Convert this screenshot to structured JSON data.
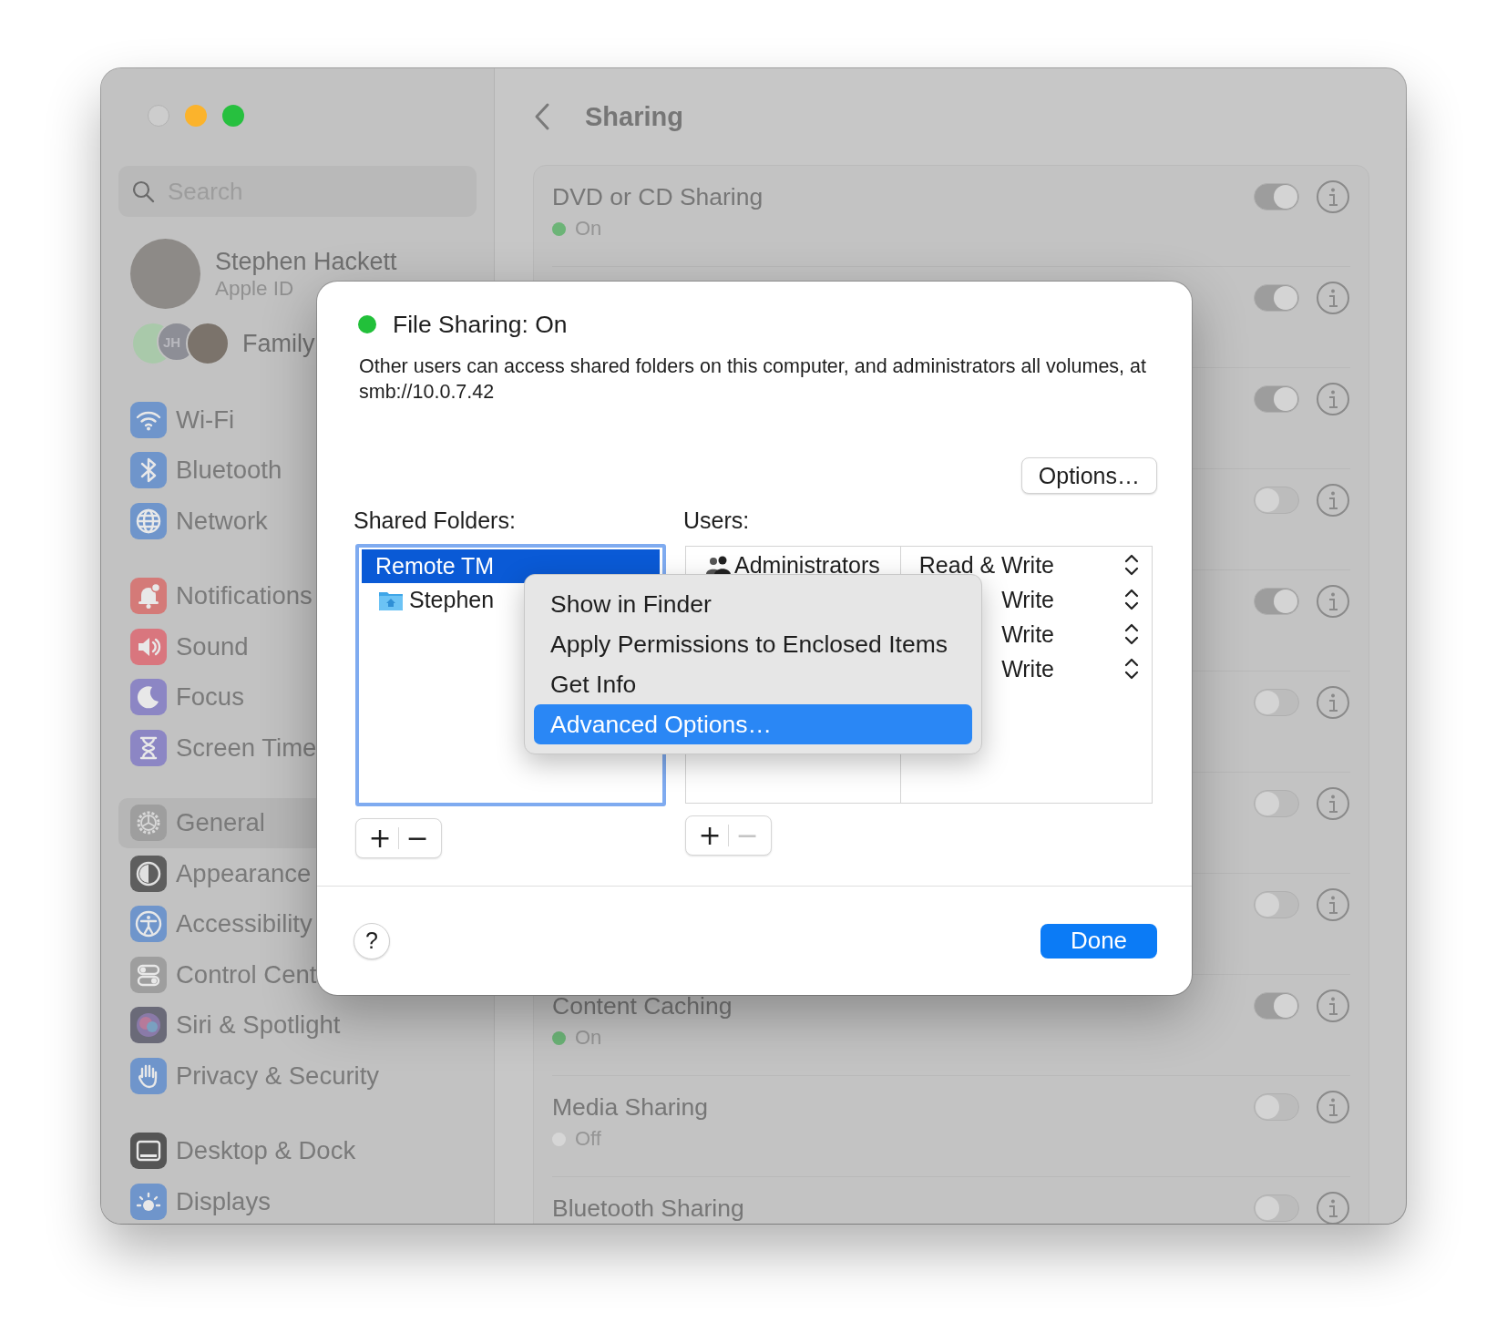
{
  "window": {
    "title": "Sharing"
  },
  "sidebar": {
    "search": {
      "placeholder": "Search"
    },
    "account": {
      "name": "Stephen Hackett",
      "subtitle": "Apple ID"
    },
    "family": {
      "label": "Family",
      "initials": "JH"
    },
    "groups": [
      [
        {
          "label": "Wi-Fi",
          "selected": false
        },
        {
          "label": "Bluetooth",
          "selected": false
        },
        {
          "label": "Network",
          "selected": false
        }
      ],
      [
        {
          "label": "Notifications",
          "selected": false
        },
        {
          "label": "Sound",
          "selected": false
        },
        {
          "label": "Focus",
          "selected": false
        },
        {
          "label": "Screen Time",
          "selected": false
        }
      ],
      [
        {
          "label": "General",
          "selected": true
        },
        {
          "label": "Appearance",
          "selected": false
        },
        {
          "label": "Accessibility",
          "selected": false
        },
        {
          "label": "Control Cent",
          "selected": false
        },
        {
          "label": "Siri & Spotlight",
          "selected": false
        },
        {
          "label": "Privacy & Security",
          "selected": false
        }
      ],
      [
        {
          "label": "Desktop & Dock",
          "selected": false
        },
        {
          "label": "Displays",
          "selected": false
        }
      ]
    ]
  },
  "services": [
    {
      "title": "DVD or CD Sharing",
      "status": "On",
      "on": true
    },
    {
      "on": true
    },
    {
      "on": true
    },
    {
      "on": false
    },
    {
      "on": true
    },
    {
      "on": false
    },
    {
      "on": false
    },
    {
      "on": false
    },
    {
      "title": "Content Caching",
      "status": "On",
      "on": true
    },
    {
      "title": "Media Sharing",
      "status": "Off",
      "on": false
    },
    {
      "title": "Bluetooth Sharing",
      "on": false
    }
  ],
  "sheet": {
    "status": {
      "label": "File Sharing: On",
      "on": true
    },
    "description": "Other users can access shared folders on this computer, and administrators all volumes, at smb://10.0.7.42",
    "options_button": "Options…",
    "shared_folders": {
      "label": "Shared Folders:",
      "items": [
        {
          "name": "Remote TM",
          "kind": "volume",
          "selected": true
        },
        {
          "name": "Stephen",
          "kind": "home",
          "selected": false
        }
      ],
      "add": {
        "label": "+",
        "disabled": false
      },
      "remove": {
        "label": "−",
        "disabled": false
      }
    },
    "users": {
      "label": "Users:",
      "rows": [
        {
          "name": "Administrators",
          "permission": "Read & Write"
        },
        {
          "permission": "Write"
        },
        {
          "permission": "Write"
        },
        {
          "permission": "Write"
        }
      ],
      "add": {
        "label": "+",
        "disabled": false
      },
      "remove": {
        "label": "−",
        "disabled": true
      }
    },
    "help_button": "?",
    "done_button": "Done",
    "context_menu": [
      {
        "label": "Show in Finder",
        "selected": false
      },
      {
        "label": "Apply Permissions to Enclosed Items",
        "selected": false
      },
      {
        "label": "Get Info",
        "selected": false
      },
      {
        "label": "Advanced Options…",
        "selected": true
      }
    ]
  }
}
